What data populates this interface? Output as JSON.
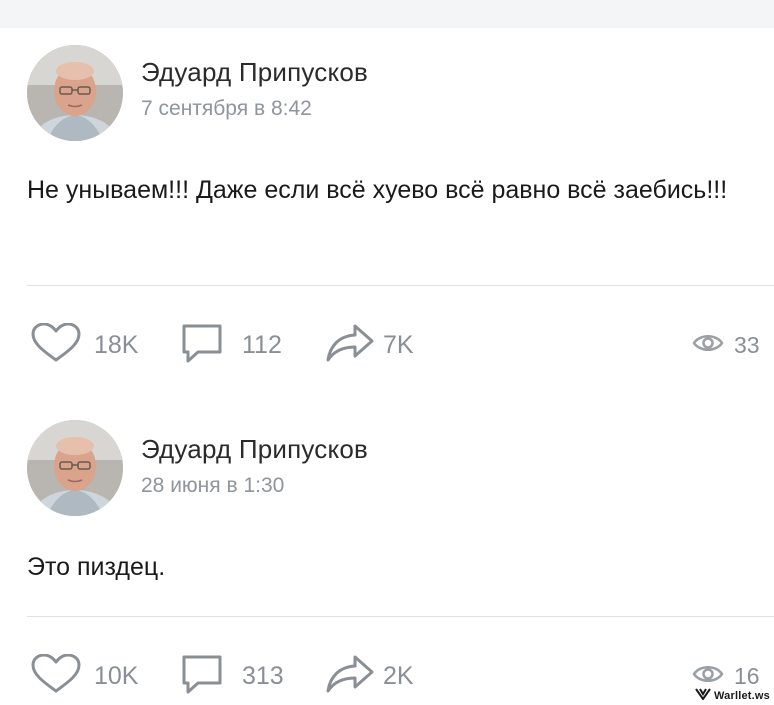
{
  "posts": [
    {
      "author": "Эдуард Припусков",
      "date": "7 сентября в 8:42",
      "text": "Не унываем!!! Даже если всё хуево всё равно всё заебись!!!",
      "likes": "18K",
      "comments": "112",
      "shares": "7K",
      "views": "33"
    },
    {
      "author": "Эдуард Припусков",
      "date": "28 июня в 1:30",
      "text": "Это пиздец.",
      "likes": "10K",
      "comments": "313",
      "shares": "2K",
      "views": "16"
    }
  ],
  "watermark": "Warllet.ws",
  "icons": {
    "like": "heart-icon",
    "comment": "comment-icon",
    "share": "share-icon",
    "views": "eye-icon"
  },
  "colors": {
    "icon": "#8a8f95",
    "date": "#8f959b",
    "divider": "#dfe2e5"
  }
}
